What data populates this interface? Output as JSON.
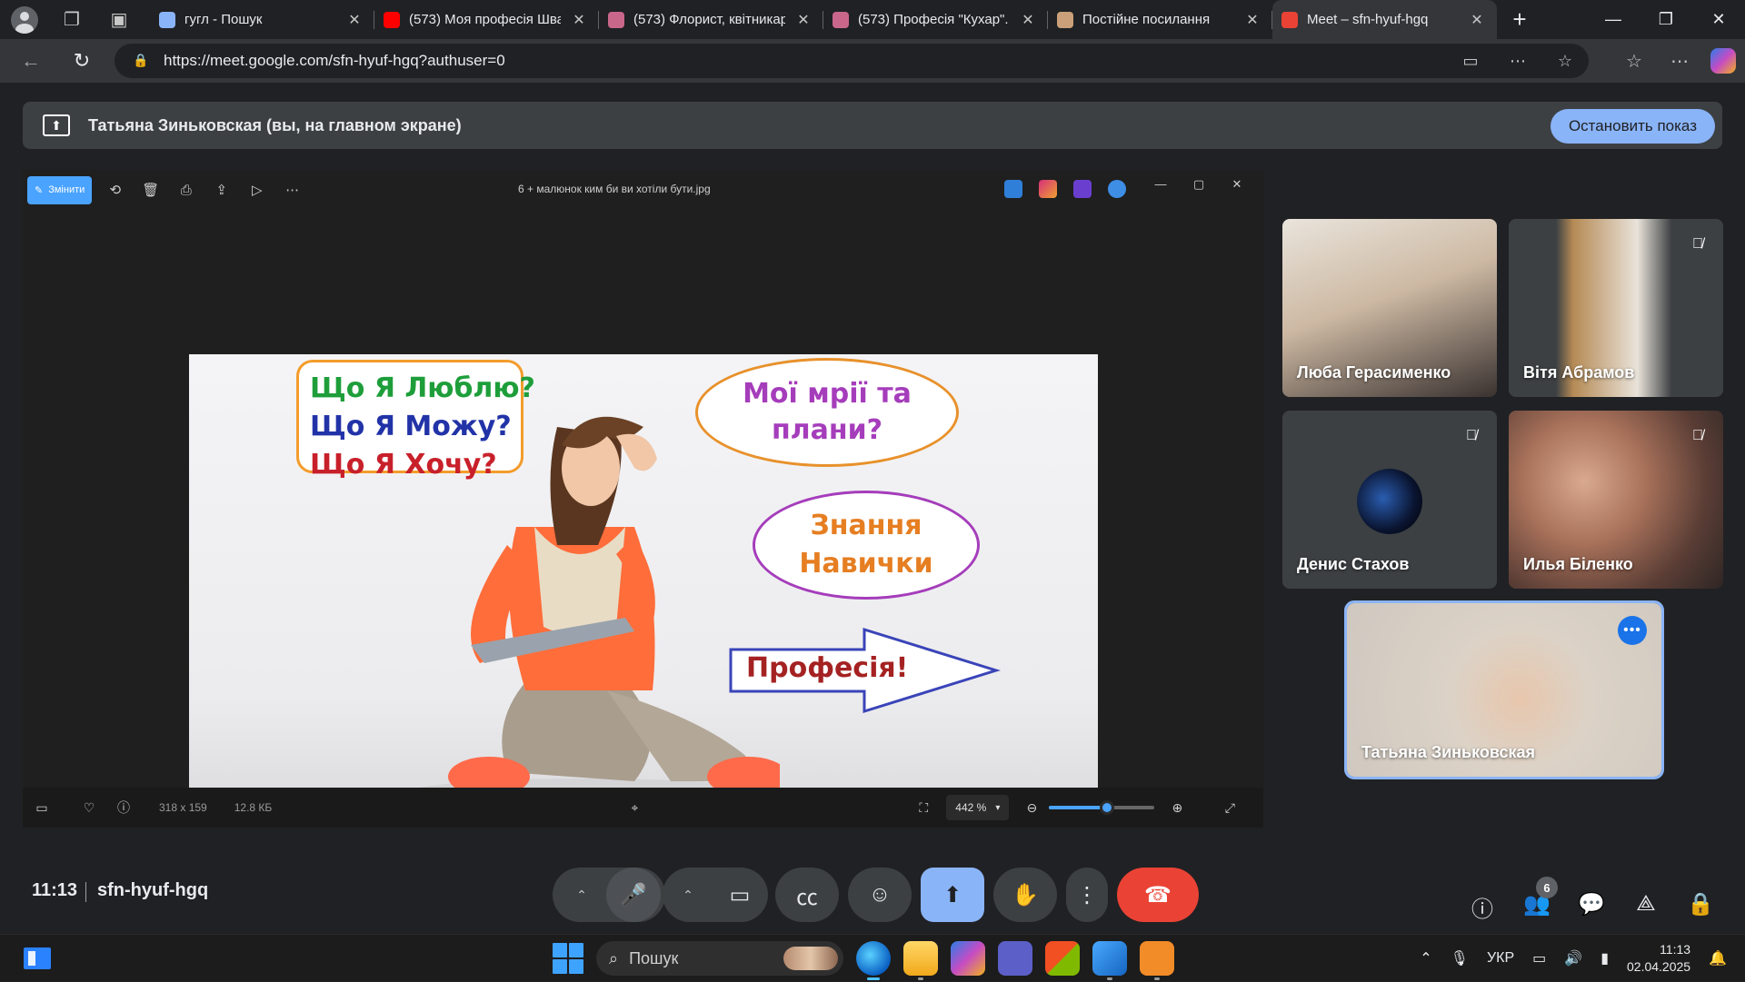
{
  "browser": {
    "tabs": [
      {
        "title": "гугл - Пошук",
        "favicon": "search-icon",
        "color": "#8ab4f8"
      },
      {
        "title": "(573) Моя професія Шва",
        "favicon": "youtube-icon",
        "color": "#ff0000"
      },
      {
        "title": "(573) Флорист, квітникар",
        "favicon": "youtube-icon",
        "color": "#c9678b"
      },
      {
        "title": "(573) Професія \"Кухар\". -",
        "favicon": "youtube-icon",
        "color": "#c9678b"
      },
      {
        "title": "Постійне посилання",
        "favicon": "page-icon",
        "color": "#c9a07a"
      },
      {
        "title": "Meet – sfn-hyuf-hgq",
        "favicon": "meet-icon",
        "color": "#ea4335",
        "active": true
      }
    ],
    "url": "https://meet.google.com/sfn-hyuf-hgq?authuser=0"
  },
  "meet": {
    "presenting_banner": "Татьяна Зиньковская (вы, на главном экране)",
    "stop_presenting": "Остановить показ",
    "time": "11:13",
    "meeting_code": "sfn-hyuf-hgq",
    "participant_count": "6",
    "participants": [
      {
        "name": "Люба Герасименко",
        "muted": false
      },
      {
        "name": "Вітя Абрамов",
        "muted": true
      },
      {
        "name": "Денис Стахов",
        "muted": true
      },
      {
        "name": "Илья Біленко",
        "muted": true
      },
      {
        "name": "Татьяна Зиньковская",
        "muted": false,
        "speaking": true
      }
    ]
  },
  "photos_app": {
    "edit_label": "Змінити",
    "file_title": "6 + малюнок ким би ви хотіли бути.jpg",
    "dimensions": "318 x 159",
    "file_size": "12.8 КБ",
    "zoom": "442 %",
    "zoom_level": 0.55
  },
  "image": {
    "questions": [
      "Що Я Люблю?",
      "Що Я Можу?",
      "Що Я Хочу?"
    ],
    "question_colors": [
      "#1e9e3a",
      "#2233a8",
      "#c8202a"
    ],
    "dream_line1": "Мої мрії та",
    "dream_line2": "плани?",
    "skills_line1": "Знання",
    "skills_line2": "Навички",
    "profession": "Професія!"
  },
  "taskbar": {
    "search_placeholder": "Пошук",
    "language": "УКР",
    "time": "11:13",
    "date": "02.04.2025"
  }
}
